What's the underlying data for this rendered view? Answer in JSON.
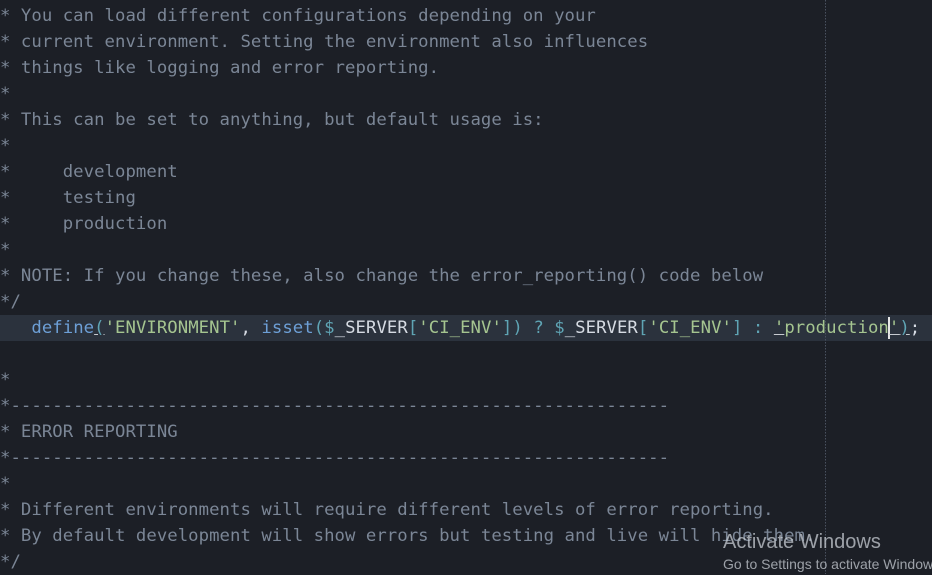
{
  "editor": {
    "language": "php",
    "lines_before": [
      "* You can load different configurations depending on your",
      "* current environment. Setting the environment also influences",
      "* things like logging and error reporting.",
      "*",
      "* This can be set to anything, but default usage is:",
      "*",
      "*     development",
      "*     testing",
      "*     production",
      "*",
      "* NOTE: If you change these, also change the error_reporting() code below",
      "*/"
    ],
    "current_line": {
      "indent": "   ",
      "fn_define": "define",
      "paren_open": "(",
      "str_environment": "'ENVIRONMENT'",
      "comma": ", ",
      "fn_isset": "isset",
      "paren_open2": "(",
      "dollar1": "$",
      "var_server1": "_SERVER",
      "bracket_open1": "[",
      "str_ci_env1": "'CI_ENV'",
      "bracket_close1": "]",
      "paren_close2": ")",
      "ternary_q": " ? ",
      "dollar2": "$",
      "var_server2": "_SERVER",
      "bracket_open2": "[",
      "str_ci_env2": "'CI_ENV'",
      "bracket_close2": "]",
      "ternary_colon": " : ",
      "str_production_open": "'",
      "str_production_body": "production",
      "str_production_close": "'",
      "paren_close": ")",
      "semicolon": ";"
    },
    "lines_after": [
      "",
      "*",
      "*---------------------------------------------------------------",
      "* ERROR REPORTING",
      "*---------------------------------------------------------------",
      "*",
      "* Different environments will require different levels of error reporting.",
      "* By default development will show errors but testing and live will hide them.",
      "*/"
    ]
  },
  "watermark": {
    "title": "Activate Windows",
    "subtitle": "Go to Settings to activate Windows."
  },
  "colors": {
    "background": "#1c1f26",
    "current_line": "#2b323d",
    "comment": "#7b8696",
    "function": "#6d9fd6",
    "string": "#a5c590",
    "punctuation": "#5fa4b4",
    "variable": "#d6dbe3"
  }
}
